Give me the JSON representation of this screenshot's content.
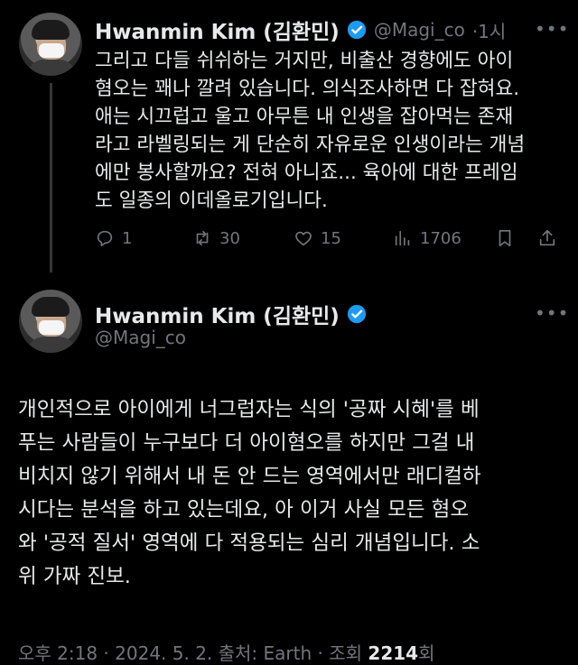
{
  "tweet1": {
    "name": "Hwanmin Kim (김환민)",
    "handle": "@Magi_co",
    "time": "·1시",
    "text": "그리고 다들 쉬쉬하는 거지만, 비출산 경향에도 아이\n혐오는 꽤나 깔려 있습니다. 의식조사하면 다 잡혀요.\n애는 시끄럽고 울고 아무튼 내 인생을 잡아먹는 존재\n라고 라벨링되는 게 단순히 자유로운 인생이라는 개념\n에만 봉사할까요? 전혀 아니죠... 육아에 대한 프레임\n도 일종의 이데올로기입니다.",
    "replies": "1",
    "retweets": "30",
    "likes": "15",
    "views": "1706"
  },
  "tweet2": {
    "name": "Hwanmin Kim (김환민)",
    "handle": "@Magi_co",
    "text": "개인적으로 아이에게 너그럽자는 식의 '공짜 시혜'를 베\n푸는 사람들이 누구보다 더 아이혐오를 하지만 그걸 내\n비치지 않기 위해서 내 돈 안 드는 영역에서만 래디컬하\n시다는 분석을 하고 있는데요, 아 이거 사실 모든 혐오\n와 '공적 질서' 영역에 다 적용되는 심리 개념입니다. 소\n위 가짜 진보.",
    "meta_prefix": "오후 2:18 · 2024. 5. 2. 출처: Earth · 조회 ",
    "views_count": "2214",
    "views_suffix": "회"
  },
  "icons": {
    "verified": "verified-badge-icon",
    "reply": "reply-icon",
    "retweet": "retweet-icon",
    "like": "heart-icon",
    "views": "views-bar-icon",
    "bookmark": "bookmark-icon",
    "share": "share-icon",
    "more": "more-icon"
  },
  "colors": {
    "background": "#000000",
    "text": "#e7e9ea",
    "muted": "#71767b",
    "verified": "#1d9bf0"
  }
}
